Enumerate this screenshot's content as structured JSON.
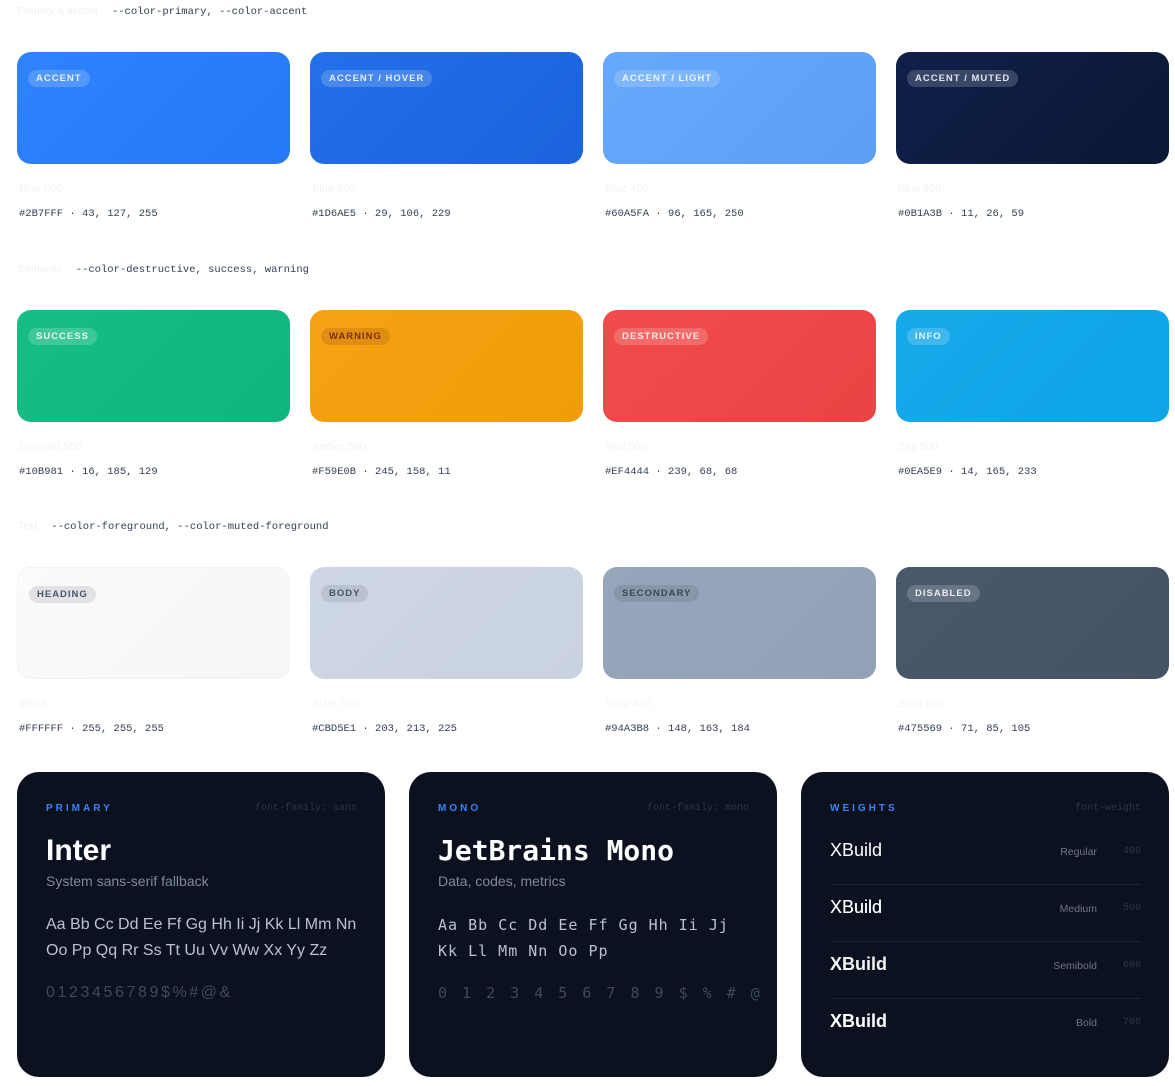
{
  "sections": [
    {
      "title": "Primary & accent",
      "vars": "--color-primary, --color-accent",
      "swatches": [
        {
          "label": "Accent",
          "name": "Blue 500",
          "hex": "#2B7FFF",
          "rgb": "43, 127, 255",
          "color": "#2B7FFF"
        },
        {
          "label": "Accent / Hover",
          "name": "Blue 600",
          "hex": "#1D6AE5",
          "rgb": "29, 106, 229",
          "color": "#1D6AE5"
        },
        {
          "label": "Accent / Light",
          "name": "Blue 400",
          "hex": "#60A5FA",
          "rgb": "96, 165, 250",
          "color": "#60A5FA"
        },
        {
          "label": "Accent / Muted",
          "name": "Blue 950",
          "hex": "#0B1A3B",
          "rgb": "11, 26, 59",
          "color": "#0B1A3B"
        }
      ]
    },
    {
      "title": "Semantic",
      "vars": "--color-destructive, success, warning",
      "swatches": [
        {
          "label": "Success",
          "name": "Emerald 500",
          "hex": "#10B981",
          "rgb": "16, 185, 129",
          "color": "#10B981"
        },
        {
          "label": "Warning",
          "name": "Amber 500",
          "hex": "#F59E0B",
          "rgb": "245, 158, 11",
          "color": "#F59E0B"
        },
        {
          "label": "Destructive",
          "name": "Red 500",
          "hex": "#EF4444",
          "rgb": "239, 68, 68",
          "color": "#EF4444"
        },
        {
          "label": "Info",
          "name": "Sky 500",
          "hex": "#0EA5E9",
          "rgb": "14, 165, 233",
          "color": "#0EA5E9"
        }
      ]
    },
    {
      "title": "Text",
      "vars": "--color-foreground, --color-muted-foreground",
      "swatches": [
        {
          "label": "Heading",
          "name": "White",
          "hex": "#FFFFFF",
          "rgb": "255, 255, 255",
          "color": "#FAFBFC"
        },
        {
          "label": "Body",
          "name": "Slate 300",
          "hex": "#CBD5E1",
          "rgb": "203, 213, 225",
          "color": "#CBD5E1"
        },
        {
          "label": "Secondary",
          "name": "Slate 400",
          "hex": "#94A3B8",
          "rgb": "148, 163, 184",
          "color": "#94A3B8"
        },
        {
          "label": "Disabled",
          "name": "Slate 600",
          "hex": "#475569",
          "rgb": "71, 85, 105",
          "color": "#475569"
        }
      ]
    }
  ],
  "typography": {
    "primary": {
      "eyebrow": "PRIMARY",
      "meta": "font-family: sans",
      "family": "Inter",
      "sub": "System sans-serif fallback",
      "glyphs": "Aa Bb Cc Dd Ee Ff Gg Hh Ii Jj Kk Ll Mm Nn Oo Pp Qq Rr Ss Tt Uu Vv Ww Xx Yy Zz",
      "digits": "0123456789$%#@&"
    },
    "mono": {
      "eyebrow": "MONO",
      "meta": "font-family: mono",
      "family": "JetBrains Mono",
      "sub": "Data, codes, metrics",
      "glyphs": "Aa Bb Cc Dd Ee Ff Gg Hh Ii Jj Kk Ll Mm Nn Oo Pp",
      "digits": "0 1 2 3 4 5 6 7 8 9 $ % # @"
    },
    "weights": {
      "eyebrow": "WEIGHTS",
      "meta": "font-weight",
      "rows": [
        {
          "sample": "XBuild",
          "name": "Regular",
          "value": "400",
          "weight": 400
        },
        {
          "sample": "XBuild",
          "name": "Medium",
          "value": "500",
          "weight": 500
        },
        {
          "sample": "XBuild",
          "name": "Semibold",
          "value": "600",
          "weight": 600
        },
        {
          "sample": "XBuild",
          "name": "Bold",
          "value": "700",
          "weight": 700
        }
      ]
    }
  }
}
